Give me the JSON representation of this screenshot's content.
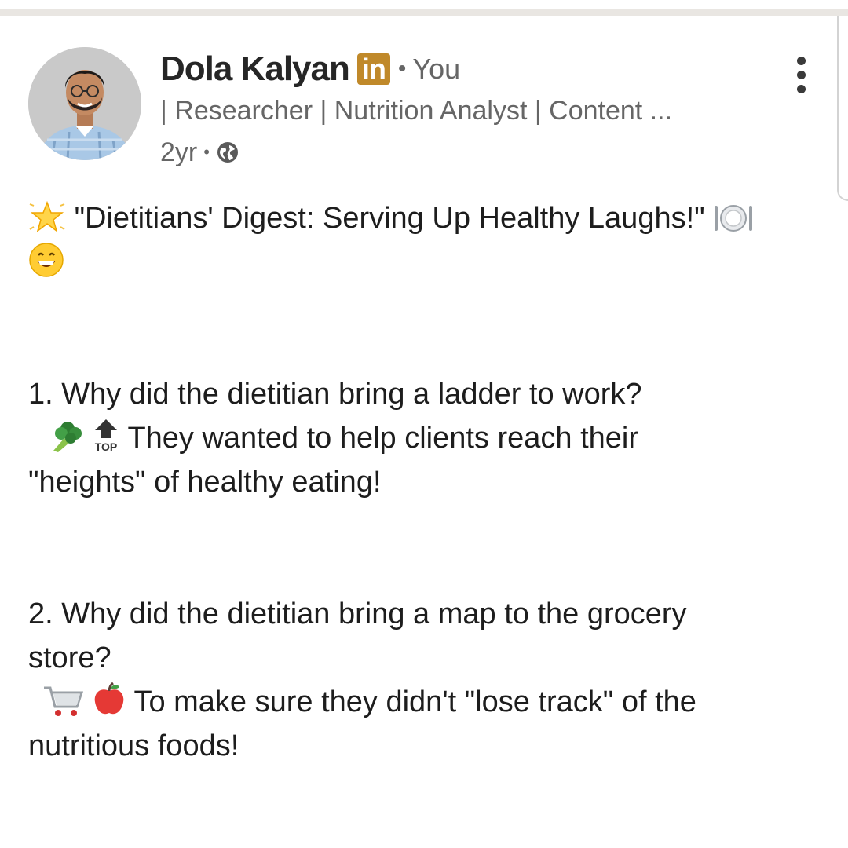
{
  "post": {
    "author": {
      "name": "Dola Kalyan",
      "badge": "in",
      "relation": "You",
      "headline": "| Researcher | Nutrition Analyst | Content ...",
      "age": "2yr",
      "visibility_icon": "globe-icon"
    },
    "menu_icon": "more-vertical-icon",
    "body": {
      "title": "\"Dietitians' Digest: Serving Up Healthy Laughs!\"",
      "joke1_question": "1. Why did the dietitian bring a ladder to work?",
      "joke1_answer_line1": "They wanted to help clients reach their",
      "joke1_answer_line2": "\"heights\" of healthy eating!",
      "joke2_question_line1": "2. Why did the dietitian bring a map to the grocery",
      "joke2_question_line2": "store?",
      "joke2_answer_line1": "To make sure they didn't \"lose track\" of the",
      "joke2_answer_line2": "nutritious foods!",
      "top_label": "TOP"
    },
    "colors": {
      "badge": "#c0892a",
      "text": "#1d1d1d",
      "muted": "#666666"
    }
  }
}
